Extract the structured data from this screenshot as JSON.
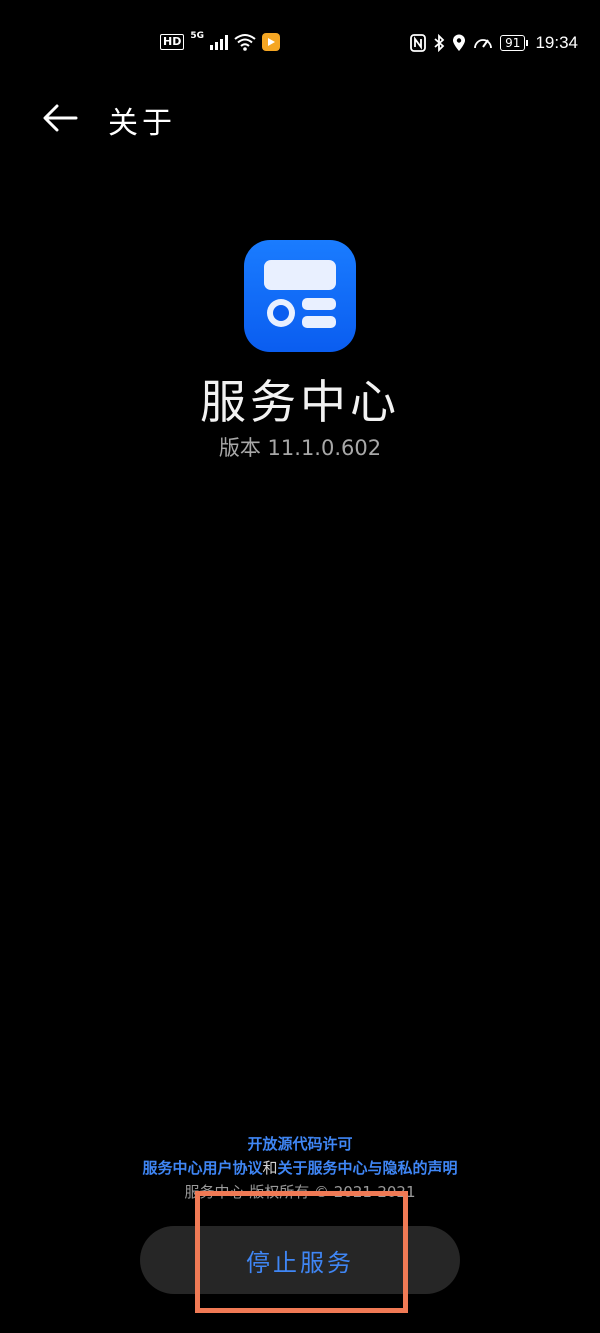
{
  "status_bar": {
    "hd": "HD",
    "network": "5G",
    "battery": "91",
    "time": "19:34",
    "app_badge_color": "#f5a623"
  },
  "header": {
    "title": "关于",
    "back_icon": "arrow-left-icon"
  },
  "app": {
    "name": "服务中心",
    "version": "版本 11.1.0.602",
    "icon_color": "#0a5df0"
  },
  "footer": {
    "open_source_link": "开放源代码许可",
    "user_agreement_link": "服务中心用户协议",
    "conjunction": "和",
    "privacy_link": "关于服务中心与隐私的声明",
    "copyright": "服务中心 版权所有 © 2021-2021"
  },
  "actions": {
    "stop_service_label": "停止服务"
  },
  "colors": {
    "link": "#3f86f5",
    "highlight": "#f07a55",
    "background": "#000000"
  }
}
